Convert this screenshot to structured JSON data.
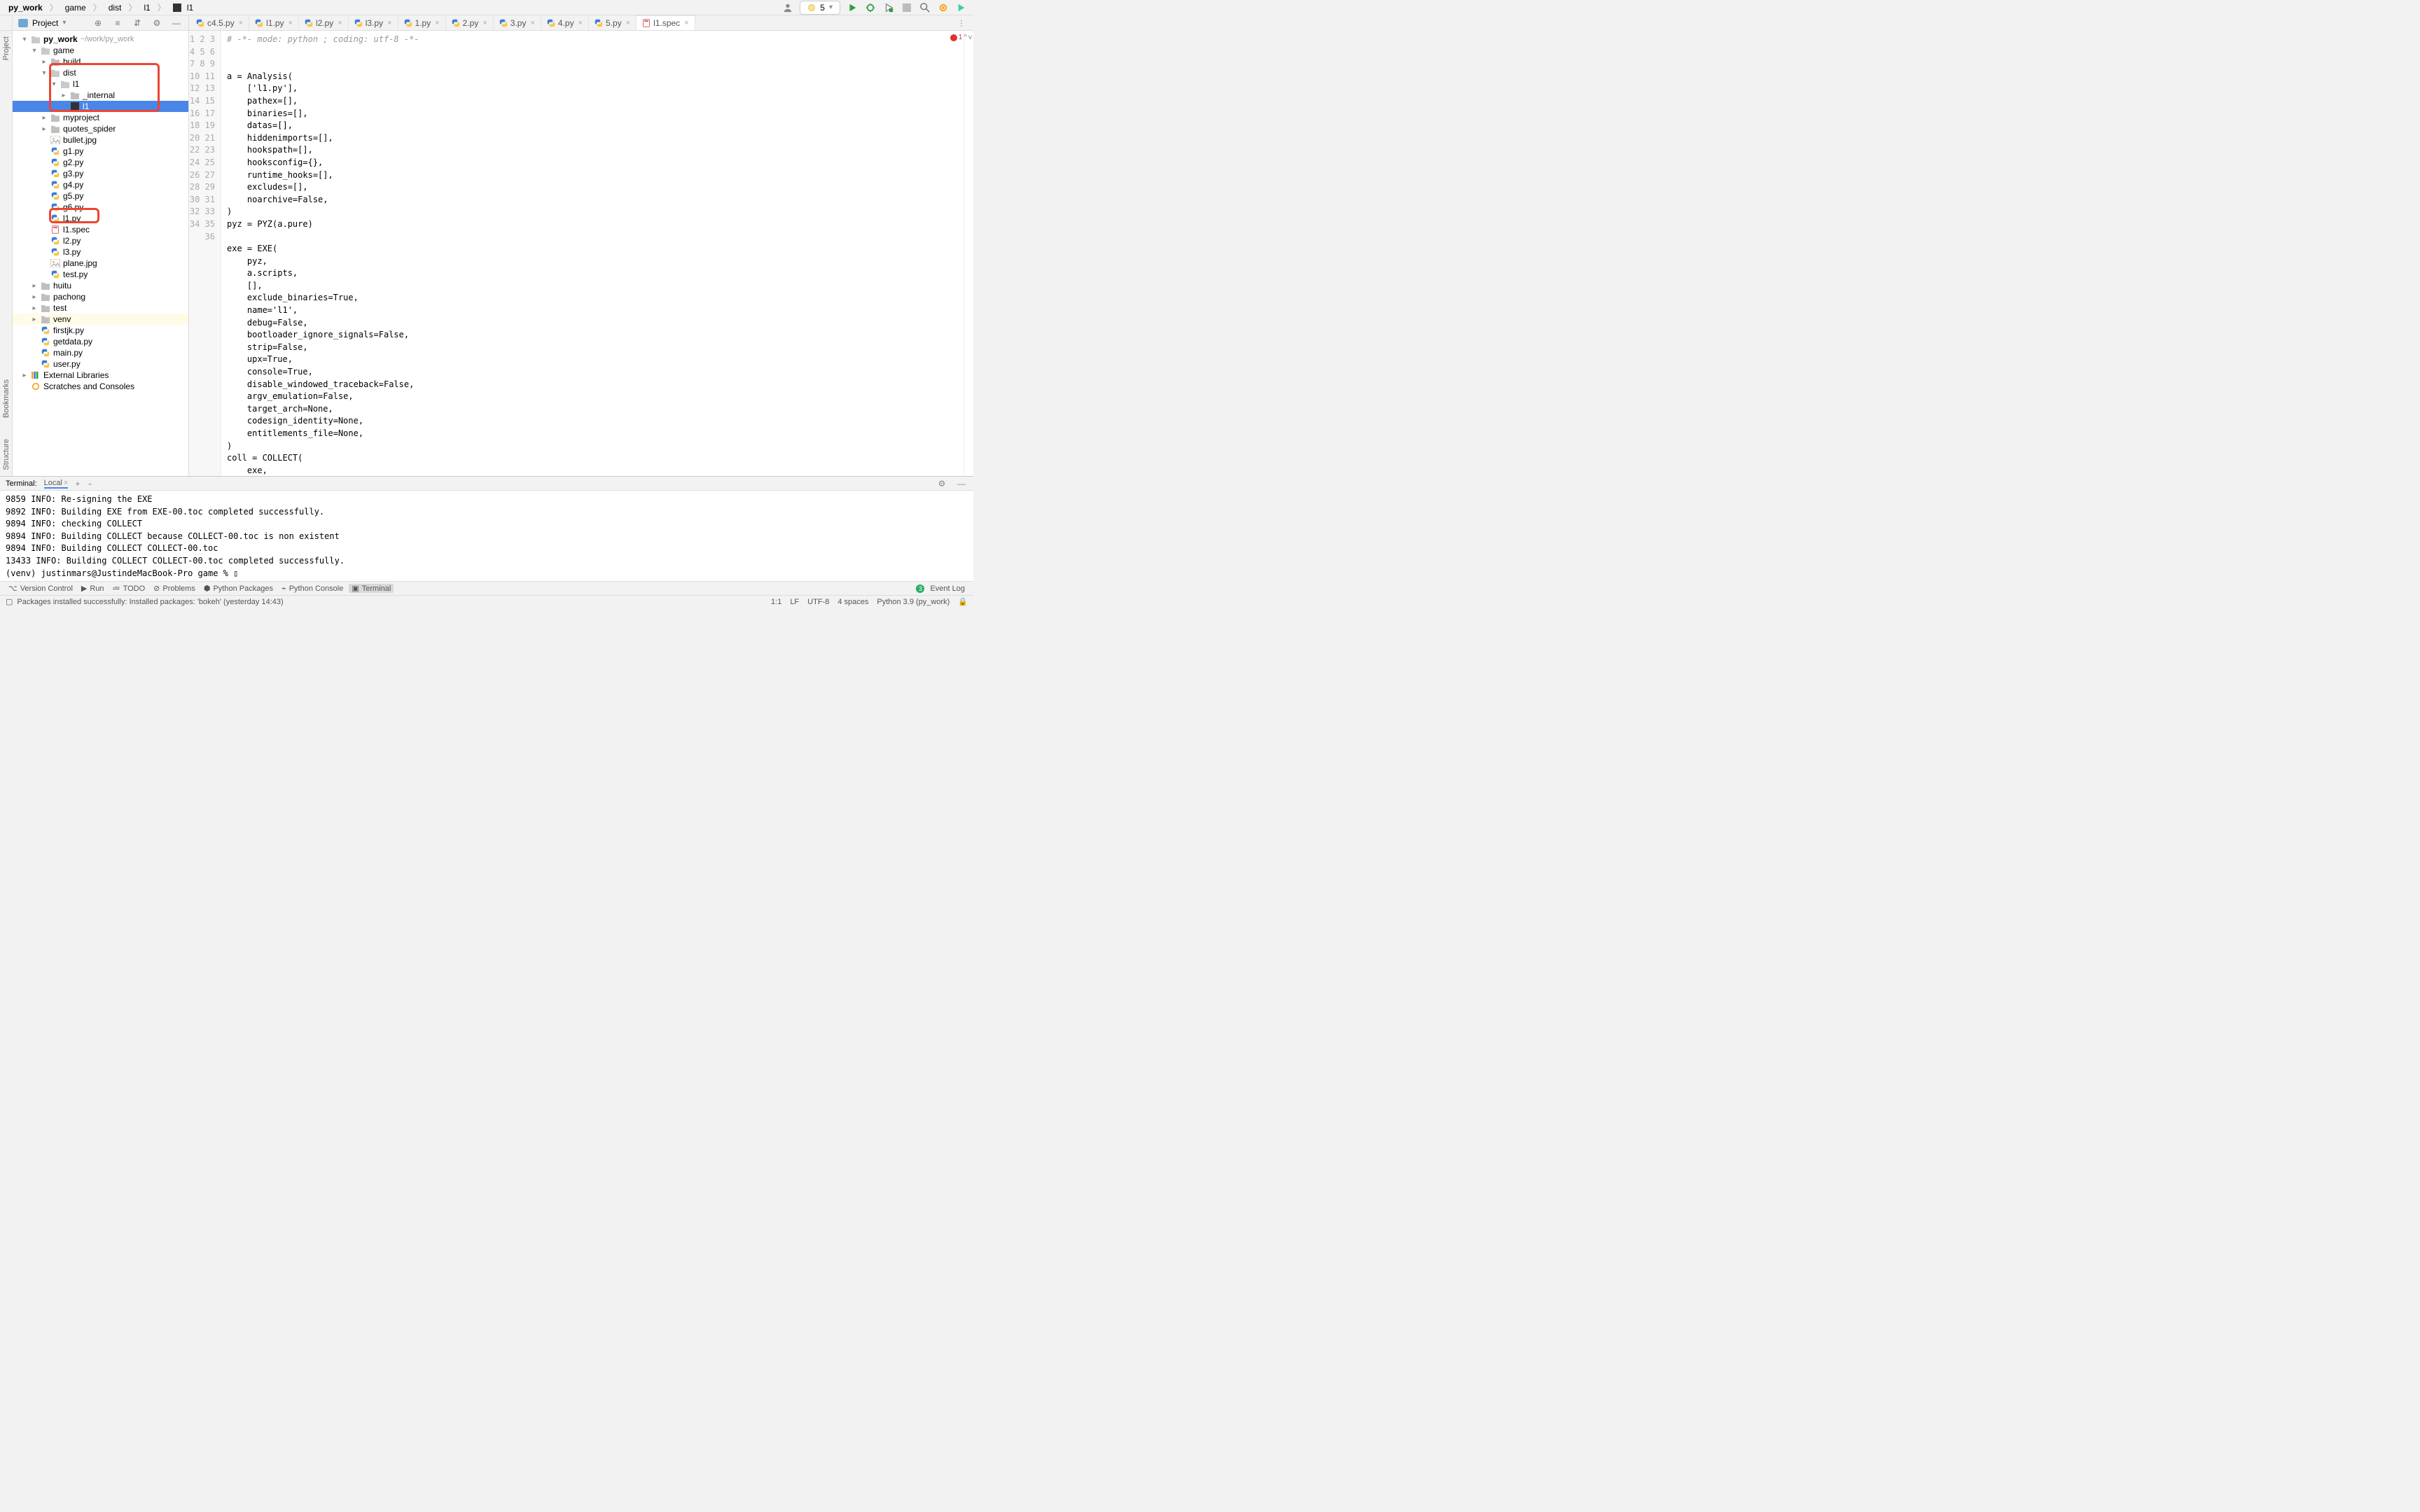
{
  "breadcrumbs": [
    "py_work",
    "game",
    "dist",
    "l1",
    "l1"
  ],
  "run_config": {
    "label": "5"
  },
  "toolbar_icons": [
    "run",
    "debug",
    "coverage",
    "stop",
    "search",
    "sync",
    "ide-update"
  ],
  "project_label": "Project",
  "tabs": [
    {
      "name": "c4.5.py",
      "icon": "py"
    },
    {
      "name": "l1.py",
      "icon": "py"
    },
    {
      "name": "l2.py",
      "icon": "py"
    },
    {
      "name": "l3.py",
      "icon": "py"
    },
    {
      "name": "1.py",
      "icon": "py"
    },
    {
      "name": "2.py",
      "icon": "py"
    },
    {
      "name": "3.py",
      "icon": "py"
    },
    {
      "name": "4.py",
      "icon": "py"
    },
    {
      "name": "5.py",
      "icon": "py"
    },
    {
      "name": "l1.spec",
      "icon": "spec",
      "active": true
    }
  ],
  "tree": {
    "root": {
      "name": "py_work",
      "path": "~/work/py_work"
    },
    "nodes": [
      {
        "d": 0,
        "k": "folder-open",
        "t": "py_work",
        "extra": "~/work/py_work",
        "caret": "▾"
      },
      {
        "d": 1,
        "k": "folder-open",
        "t": "game",
        "caret": "▾"
      },
      {
        "d": 2,
        "k": "folder",
        "t": "build",
        "caret": "▸"
      },
      {
        "d": 2,
        "k": "folder-open",
        "t": "dist",
        "caret": "▾",
        "boxtop": true
      },
      {
        "d": 3,
        "k": "folder-open",
        "t": "l1",
        "caret": "▾"
      },
      {
        "d": 4,
        "k": "folder",
        "t": "_internal",
        "caret": "▸"
      },
      {
        "d": 4,
        "k": "exe",
        "t": "l1",
        "selected": true,
        "boxbot": true
      },
      {
        "d": 2,
        "k": "folder",
        "t": "myproject",
        "caret": "▸"
      },
      {
        "d": 2,
        "k": "folder",
        "t": "quotes_spider",
        "caret": "▸"
      },
      {
        "d": 2,
        "k": "img",
        "t": "bullet.jpg"
      },
      {
        "d": 2,
        "k": "py",
        "t": "g1.py"
      },
      {
        "d": 2,
        "k": "py",
        "t": "g2.py"
      },
      {
        "d": 2,
        "k": "py",
        "t": "g3.py"
      },
      {
        "d": 2,
        "k": "py",
        "t": "g4.py"
      },
      {
        "d": 2,
        "k": "py",
        "t": "g5.py"
      },
      {
        "d": 2,
        "k": "py",
        "t": "g6.py"
      },
      {
        "d": 2,
        "k": "py",
        "t": "l1.py",
        "box2": true
      },
      {
        "d": 2,
        "k": "spec",
        "t": "l1.spec"
      },
      {
        "d": 2,
        "k": "py",
        "t": "l2.py"
      },
      {
        "d": 2,
        "k": "py",
        "t": "l3.py"
      },
      {
        "d": 2,
        "k": "img",
        "t": "plane.jpg"
      },
      {
        "d": 2,
        "k": "py",
        "t": "test.py"
      },
      {
        "d": 1,
        "k": "folder",
        "t": "huitu",
        "caret": "▸"
      },
      {
        "d": 1,
        "k": "folder",
        "t": "pachong",
        "caret": "▸"
      },
      {
        "d": 1,
        "k": "folder",
        "t": "test",
        "caret": "▸"
      },
      {
        "d": 1,
        "k": "folder-venv",
        "t": "venv",
        "caret": "▸",
        "venv": true
      },
      {
        "d": 1,
        "k": "py",
        "t": "firstjk.py"
      },
      {
        "d": 1,
        "k": "py",
        "t": "getdata.py"
      },
      {
        "d": 1,
        "k": "py",
        "t": "main.py"
      },
      {
        "d": 1,
        "k": "py",
        "t": "user.py"
      },
      {
        "d": 0,
        "k": "lib",
        "t": "External Libraries",
        "caret": "▸"
      },
      {
        "d": 0,
        "k": "scratch",
        "t": "Scratches and Consoles"
      }
    ]
  },
  "code": {
    "lines": [
      "# -*- mode: python ; coding: utf-8 -*-",
      "",
      "",
      "a = Analysis(",
      "    ['l1.py'],",
      "    pathex=[],",
      "    binaries=[],",
      "    datas=[],",
      "    hiddenimports=[],",
      "    hookspath=[],",
      "    hooksconfig={},",
      "    runtime_hooks=[],",
      "    excludes=[],",
      "    noarchive=False,",
      ")",
      "pyz = PYZ(a.pure)",
      "",
      "exe = EXE(",
      "    pyz,",
      "    a.scripts,",
      "    [],",
      "    exclude_binaries=True,",
      "    name='l1',",
      "    debug=False,",
      "    bootloader_ignore_signals=False,",
      "    strip=False,",
      "    upx=True,",
      "    console=True,",
      "    disable_windowed_traceback=False,",
      "    argv_emulation=False,",
      "    target_arch=None,",
      "    codesign_identity=None,",
      "    entitlements_file=None,",
      ")",
      "coll = COLLECT(",
      "    exe,"
    ],
    "error_count": "1"
  },
  "terminal": {
    "title": "Terminal:",
    "tab": "Local",
    "lines": [
      "9859 INFO: Re-signing the EXE",
      "9892 INFO: Building EXE from EXE-00.toc completed successfully.",
      "9894 INFO: checking COLLECT",
      "9894 INFO: Building COLLECT because COLLECT-00.toc is non existent",
      "9894 INFO: Building COLLECT COLLECT-00.toc",
      "13433 INFO: Building COLLECT COLLECT-00.toc completed successfully.",
      "(venv) justinmars@JustindeMacBook-Pro game % ▯"
    ]
  },
  "bottom_toolbar": [
    {
      "label": "Version Control",
      "icon": "vcs"
    },
    {
      "label": "Run",
      "icon": "run"
    },
    {
      "label": "TODO",
      "icon": "todo"
    },
    {
      "label": "Problems",
      "icon": "problems"
    },
    {
      "label": "Python Packages",
      "icon": "pkg"
    },
    {
      "label": "Python Console",
      "icon": "pycon"
    },
    {
      "label": "Terminal",
      "icon": "term",
      "active": true
    }
  ],
  "event_log": {
    "count": "3",
    "label": "Event Log"
  },
  "status": {
    "msg": "Packages installed successfully: Installed packages: 'bokeh' (yesterday 14:43)",
    "pos": "1:1",
    "eol": "LF",
    "enc": "UTF-8",
    "indent": "4 spaces",
    "interpreter": "Python 3.9 (py_work)"
  },
  "side_tabs_left": [
    "Project",
    "Bookmarks",
    "Structure"
  ]
}
